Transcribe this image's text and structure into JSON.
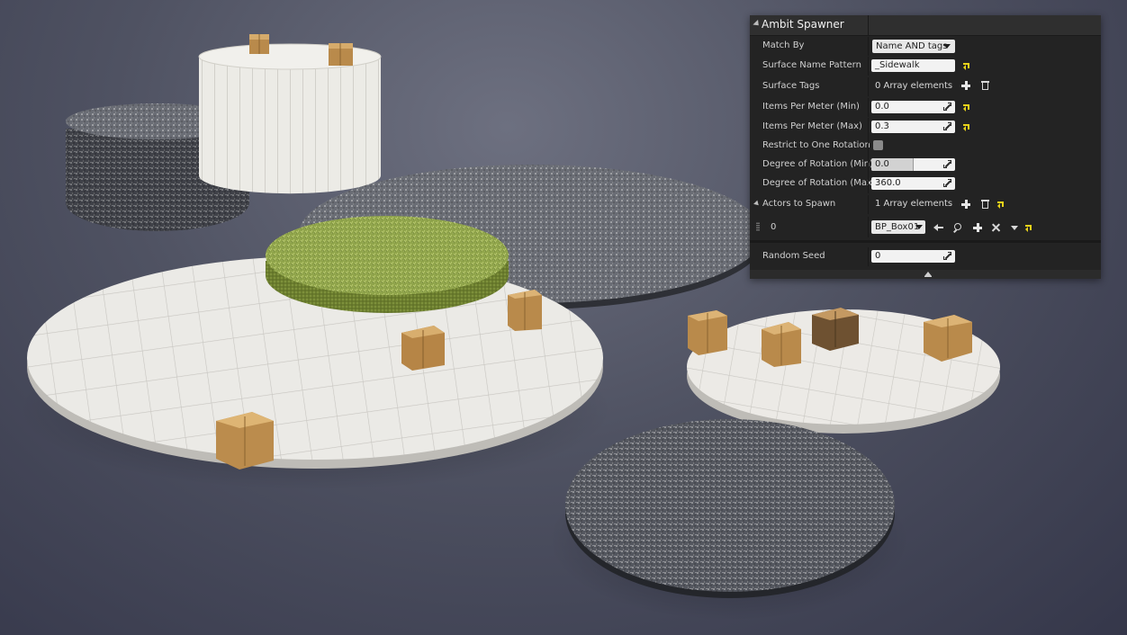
{
  "panel": {
    "title": "Ambit Spawner",
    "match_by": {
      "label": "Match By",
      "value": "Name AND tags"
    },
    "surface_name_pattern": {
      "label": "Surface Name Pattern",
      "value": "_Sidewalk"
    },
    "surface_tags": {
      "label": "Surface Tags",
      "value": "0 Array elements"
    },
    "items_per_meter_min": {
      "label": "Items Per Meter (Min)",
      "value": "0.0"
    },
    "items_per_meter_max": {
      "label": "Items Per Meter (Max)",
      "value": "0.3"
    },
    "restrict_rotation": {
      "label": "Restrict to One Rotation",
      "checked": false
    },
    "rotation_min": {
      "label": "Degree of Rotation (Min)",
      "value": "0.0",
      "fill": 0.0
    },
    "rotation_max": {
      "label": "Degree of Rotation (Max)",
      "value": "360.0"
    },
    "actors_to_spawn": {
      "label": "Actors to Spawn",
      "value": "1 Array elements"
    },
    "actor_element": {
      "index": "0",
      "value": "BP_Box01"
    },
    "random_seed": {
      "label": "Random Seed",
      "value": "0"
    }
  },
  "colors": {
    "panel_bg": "#232323",
    "reset_arrow": "#e8d21a",
    "sidewalk": "#e4e2de",
    "asphalt": "#55585f",
    "grass": "#94a94f",
    "box": "#c59a5a"
  },
  "scene": {
    "description_icons": [
      "sidewalk-disc",
      "asphalt-disc",
      "grass-disc",
      "cardboard-box"
    ]
  }
}
